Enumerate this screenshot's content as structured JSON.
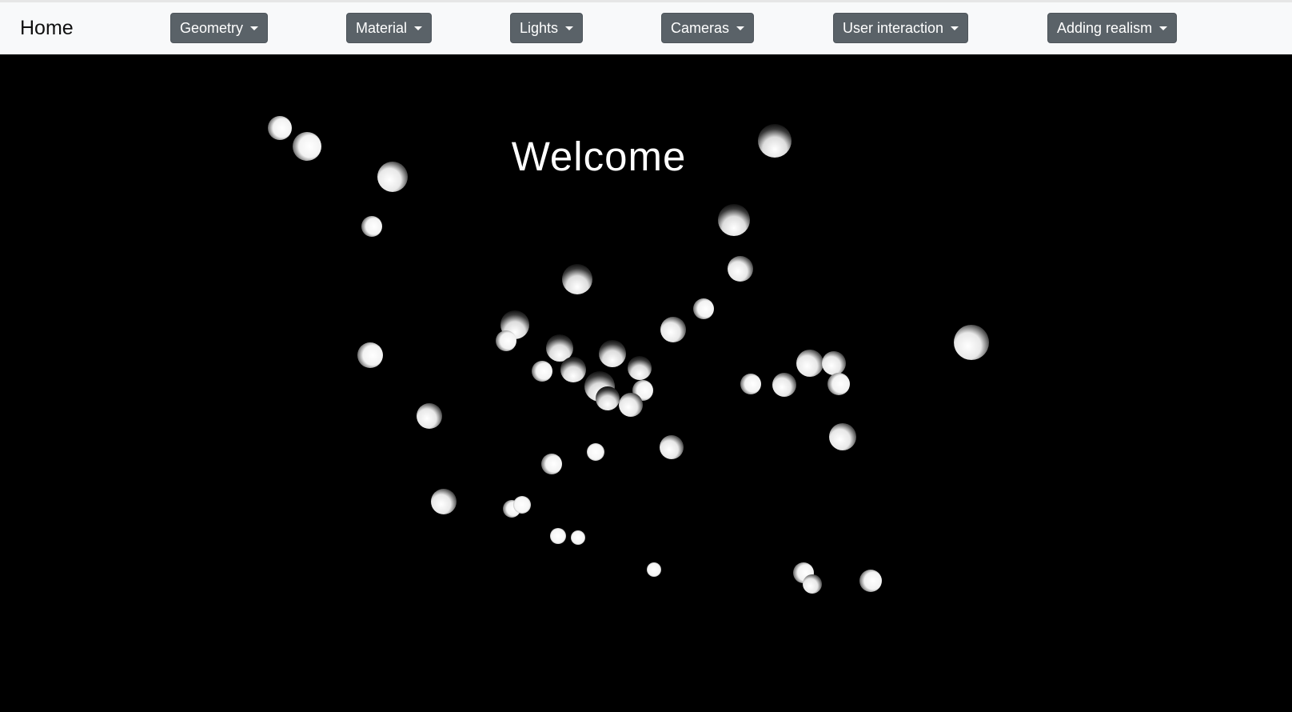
{
  "navbar": {
    "brand": "Home",
    "menus": [
      {
        "id": "geometry",
        "label": "Geometry"
      },
      {
        "id": "material",
        "label": "Material"
      },
      {
        "id": "lights",
        "label": "Lights"
      },
      {
        "id": "cameras",
        "label": "Cameras"
      },
      {
        "id": "user-interaction",
        "label": "User interaction"
      },
      {
        "id": "adding-realism",
        "label": "Adding realism"
      }
    ]
  },
  "scene": {
    "heading": "Welcome",
    "background_color": "#000000",
    "sphere_color": "#ffffff"
  }
}
